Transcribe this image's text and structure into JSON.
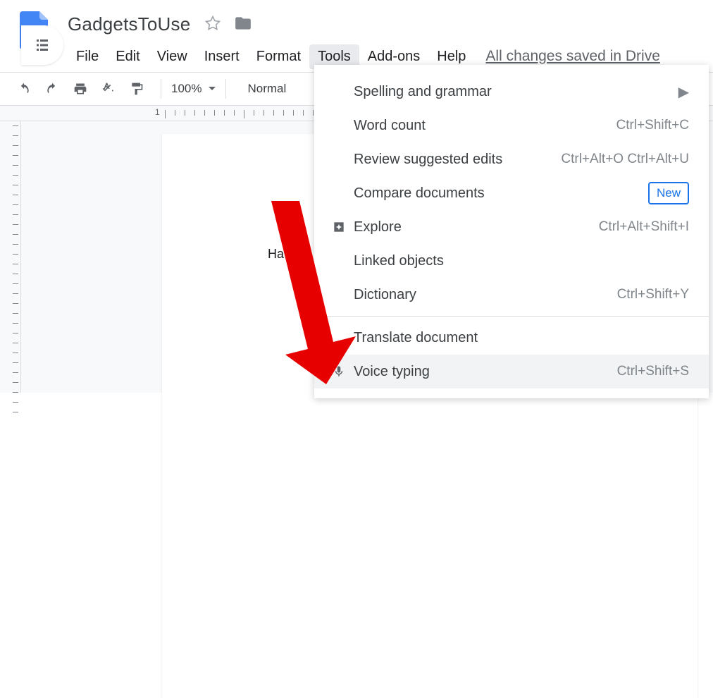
{
  "doc_title": "GadgetsToUse",
  "menubar": [
    "File",
    "Edit",
    "View",
    "Insert",
    "Format",
    "Tools",
    "Add-ons",
    "Help"
  ],
  "active_menu_index": 5,
  "save_status": "All changes saved in Drive",
  "toolbar": {
    "zoom": "100%",
    "style": "Normal"
  },
  "page_text": "Ha a ..",
  "ruler_number": "1",
  "dropdown": [
    {
      "icon": "",
      "label": "Spelling and grammar",
      "shortcut": "",
      "arrow": true
    },
    {
      "icon": "",
      "label": "Word count",
      "shortcut": "Ctrl+Shift+C"
    },
    {
      "icon": "",
      "label": "Review suggested edits",
      "shortcut": "Ctrl+Alt+O Ctrl+Alt+U"
    },
    {
      "icon": "",
      "label": "Compare documents",
      "shortcut": "",
      "badge": "New"
    },
    {
      "icon": "explore",
      "label": "Explore",
      "shortcut": "Ctrl+Alt+Shift+I"
    },
    {
      "icon": "",
      "label": "Linked objects",
      "shortcut": ""
    },
    {
      "icon": "",
      "label": "Dictionary",
      "shortcut": "Ctrl+Shift+Y"
    },
    {
      "sep": true
    },
    {
      "icon": "",
      "label": "Translate document",
      "shortcut": ""
    },
    {
      "icon": "mic",
      "label": "Voice typing",
      "shortcut": "Ctrl+Shift+S",
      "hover": true
    }
  ]
}
